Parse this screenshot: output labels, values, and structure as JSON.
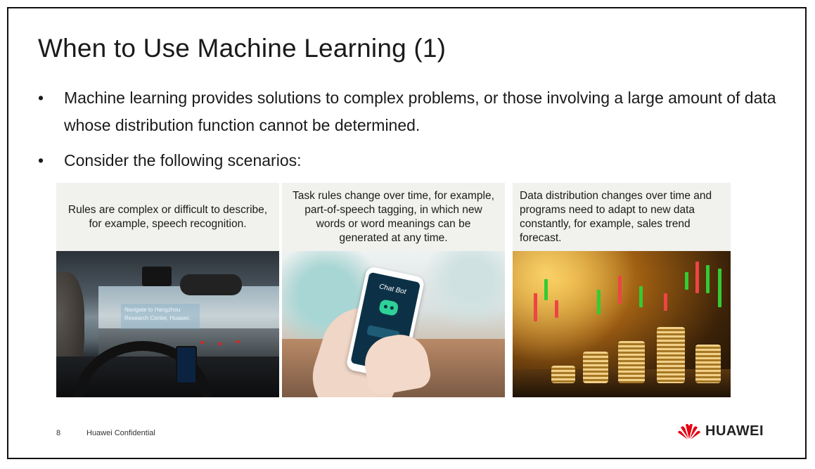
{
  "slide": {
    "title": "When to Use Machine Learning (1)",
    "bullets": [
      "Machine learning provides solutions to complex problems, or those involving a large amount of data whose distribution function cannot be determined.",
      "Consider the following scenarios:"
    ],
    "bullet_symbol": "•"
  },
  "scenarios": [
    {
      "caption": "Rules are complex or difficult to describe, for example, speech recognition.",
      "image": "car-speech-navigation-photo",
      "image_overlay_text": "Navigate to Hangzhou Research Center, Huawei."
    },
    {
      "caption": "Task rules change over time, for example, part-of-speech tagging, in which new words or word meanings can be generated at any time.",
      "image": "chat-bot-phone-photo",
      "image_overlay_text": "Chat Bot"
    },
    {
      "caption": "Data distribution changes over time and programs need to adapt to new data constantly, for example, sales trend forecast.",
      "image": "coins-candlestick-chart-photo"
    }
  ],
  "footer": {
    "page_number": "8",
    "confidentiality": "Huawei Confidential",
    "logo_text": "HUAWEI",
    "logo_color": "#e60012"
  }
}
